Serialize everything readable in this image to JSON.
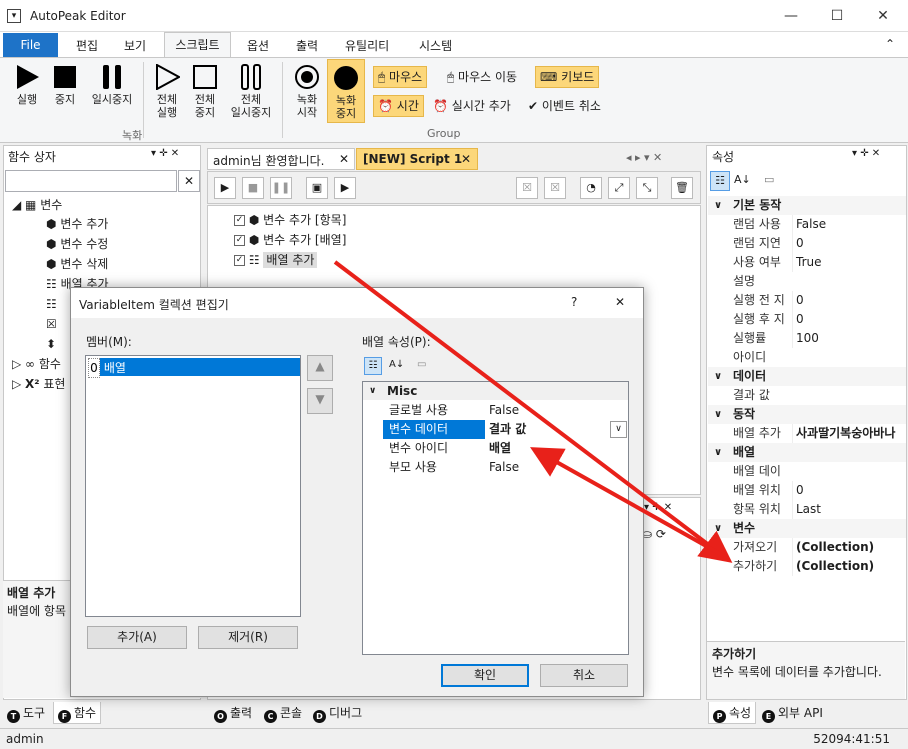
{
  "window": {
    "title": "AutoPeak Editor",
    "app_icon": "▾",
    "minimize": "—",
    "maximize": "☐",
    "close": "✕"
  },
  "menu": {
    "file": "File",
    "tabs": [
      "편집",
      "보기",
      "스크립트",
      "옵션",
      "출력",
      "유틸리티",
      "시스템"
    ],
    "collapse": "⌃"
  },
  "ribbon": {
    "rec_buttons": [
      {
        "label1": "실행",
        "label2": ""
      },
      {
        "label1": "중지",
        "label2": ""
      },
      {
        "label1": "일시중지",
        "label2": ""
      }
    ],
    "full_buttons": [
      {
        "label1": "전체",
        "label2": "실행"
      },
      {
        "label1": "전체",
        "label2": "중지"
      },
      {
        "label1": "전체",
        "label2": "일시중지"
      }
    ],
    "record_start": {
      "label1": "녹화",
      "label2": "시작"
    },
    "record_stop": {
      "label1": "녹화",
      "label2": "중지"
    },
    "mouse": "마우스",
    "mouse_move": "마우스 이동",
    "keyboard": "키보드",
    "time": "시간",
    "realtime_add": "실시간 추가",
    "event_cancel": "이벤트 취소",
    "group1": "녹화",
    "group2": "Group"
  },
  "func_panel": {
    "title": "함수 상자",
    "search_value": "",
    "clear": "✕",
    "root": "변수",
    "children": [
      "변수 추가",
      "변수 수정",
      "변수 삭제",
      "배열 추가",
      "",
      "",
      ""
    ],
    "other1": "함수",
    "other2": "표현"
  },
  "func_desc": {
    "title": "배열 추가",
    "text": "배열에 항목"
  },
  "left_tabs": [
    {
      "badge": "T",
      "label": "도구"
    },
    {
      "badge": "F",
      "label": "함수"
    }
  ],
  "doc_tabs": [
    {
      "label": "admin님 환영합니다.",
      "close": "✕"
    },
    {
      "label": "[NEW] Script 1",
      "close": "✕"
    }
  ],
  "script_items": [
    "변수 추가 [항목]",
    "변수 추가 [배열]",
    "배열 추가"
  ],
  "bottom_tabs": [
    {
      "badge": "O",
      "label": "출력"
    },
    {
      "badge": "C",
      "label": "콘솔"
    },
    {
      "badge": "D",
      "label": "디버그"
    }
  ],
  "props": {
    "title": "속성",
    "categories": [
      {
        "name": "기본 동작",
        "rows": [
          [
            "랜덤 사용",
            "False"
          ],
          [
            "랜덤 지연",
            "0"
          ],
          [
            "사용 여부",
            "True"
          ],
          [
            "설명",
            ""
          ],
          [
            "실행 전 지",
            "0"
          ],
          [
            "실행 후 지",
            "0"
          ],
          [
            "실행률",
            "100"
          ],
          [
            "아이디",
            ""
          ]
        ]
      },
      {
        "name": "데이터",
        "rows": [
          [
            "결과 값",
            ""
          ]
        ]
      },
      {
        "name": "동작",
        "rows": [
          [
            "배열 추가",
            "사과딸기복숭아바나"
          ]
        ]
      },
      {
        "name": "배열",
        "rows": [
          [
            "배열 데이",
            ""
          ],
          [
            "배열 위치",
            "0"
          ],
          [
            "항목 위치",
            "Last"
          ]
        ]
      },
      {
        "name": "변수",
        "rows": [
          [
            "가져오기",
            "(Collection)"
          ],
          [
            "추가하기",
            "(Collection)"
          ]
        ]
      }
    ],
    "desc_title": "추가하기",
    "desc_text": "변수 목록에 데이터를 추가합니다."
  },
  "right_tabs": [
    {
      "badge": "P",
      "label": "속성"
    },
    {
      "badge": "E",
      "label": "외부 API"
    }
  ],
  "dialog": {
    "title": "VariableItem 컬렉션 편집기",
    "help": "?",
    "close": "✕",
    "members_label": "멤버(M):",
    "member_index": "0",
    "member_name": "배열",
    "props_label": "배열 속성(P):",
    "category": "Misc",
    "rows": [
      [
        "글로벌 사용",
        "False"
      ],
      [
        "변수 데이터",
        "결과 값"
      ],
      [
        "변수 아이디",
        "배열"
      ],
      [
        "부모 사용",
        "False"
      ]
    ],
    "add": "추가(A)",
    "remove": "제거(R)",
    "ok": "확인",
    "cancel": "취소"
  },
  "status": {
    "user": "admin",
    "time": "52094:41:51"
  }
}
